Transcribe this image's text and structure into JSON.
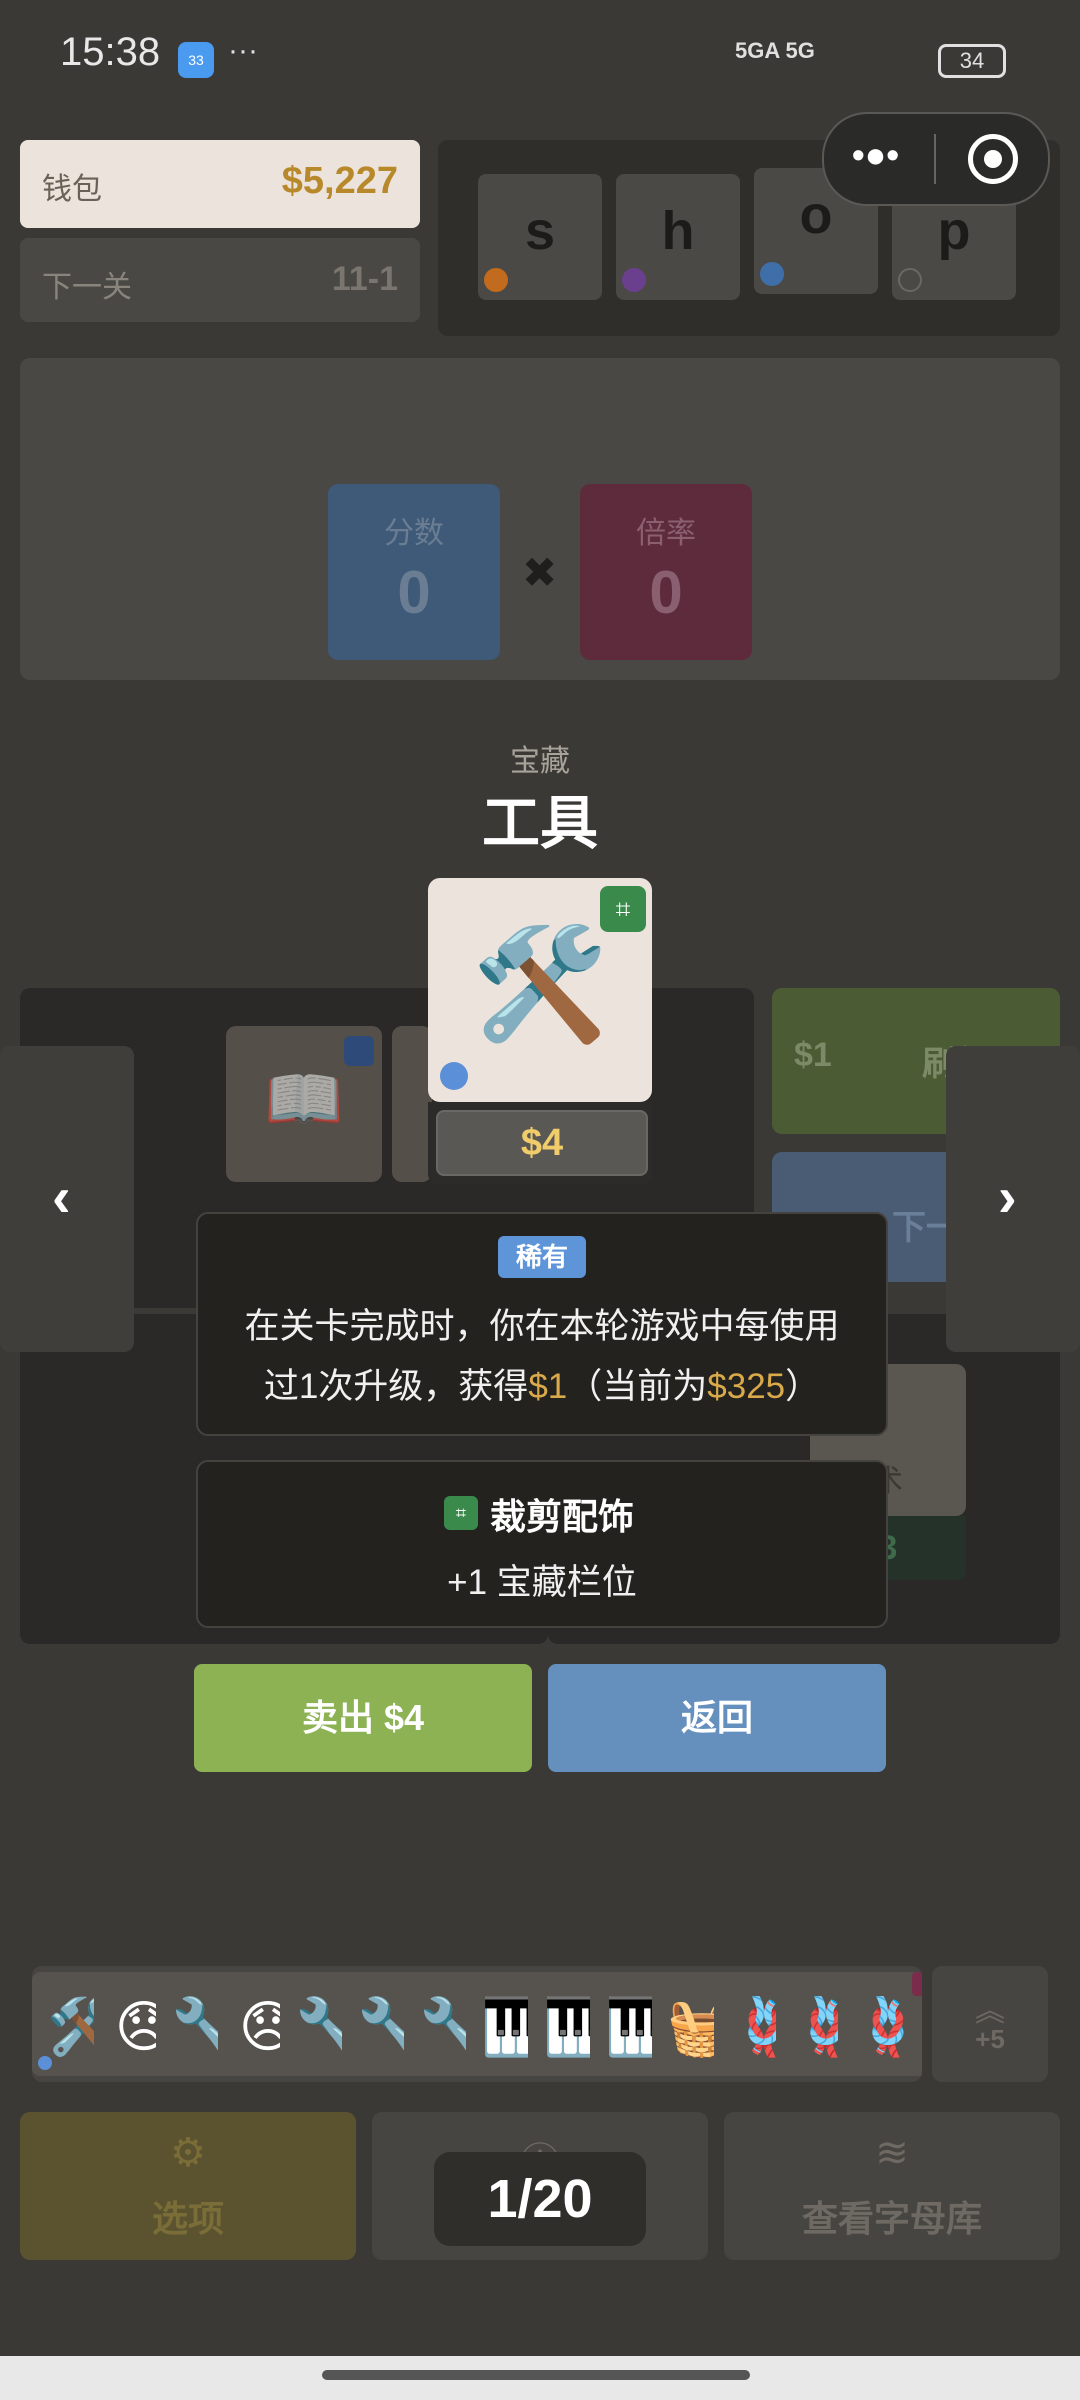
{
  "status": {
    "time": "15:38",
    "weather": "33",
    "dots": "···",
    "network": "5GA 5G",
    "battery": "34"
  },
  "header": {
    "wallet_label": "钱包",
    "wallet_value": "$5,227",
    "next_label": "下一关",
    "next_value": "11-1",
    "shop_tiles": [
      {
        "letter": "s",
        "dot": "#c26b1e"
      },
      {
        "letter": "h",
        "dot": "#6a3f8e"
      },
      {
        "letter": "o",
        "dot": "#3f6fa9"
      },
      {
        "letter": "p",
        "dot": "none"
      }
    ],
    "capsule_more": "•●•"
  },
  "scoreboard": {
    "score_label": "分数",
    "score_value": "0",
    "times": "✖",
    "mult_label": "倍率",
    "mult_value": "0",
    "score_color": "#3e5a78",
    "mult_color": "#5e2b3c"
  },
  "background": {
    "price_left": "$1",
    "refresh_label": "刷新",
    "next_level_button": "下一关",
    "arrow_left": "‹",
    "arrow_right": "›",
    "partial_price": "3",
    "partial_label": "术"
  },
  "modal": {
    "category": "宝藏",
    "title": "工具",
    "item_emoji": "🛠️",
    "item_price": "$4",
    "rarity": "稀有",
    "desc_line1": "在关卡完成时，你在本轮游戏中每使用",
    "desc_line2_a": "过1次升级，获得",
    "desc_line2_gold1": "$1",
    "desc_line2_b": "（当前为",
    "desc_line2_gold2": "$325",
    "desc_line2_c": "）",
    "accessory_title": "裁剪配饰",
    "accessory_effect": "+1 宝藏栏位",
    "sell_button": "卖出 $4",
    "back_button": "返回"
  },
  "inventory": {
    "items": [
      {
        "emoji": "🛠️",
        "badge_color": "#3a8a4c"
      },
      {
        "emoji": "😞",
        "badge_color": "#3a8a4c"
      },
      {
        "emoji": "🔧",
        "badge_color": "#3a8a4c"
      },
      {
        "emoji": "😞",
        "badge_color": "#7a2d4a"
      },
      {
        "emoji": "🔧",
        "badge_color": "#3a8a4c"
      },
      {
        "emoji": "🔧",
        "badge_color": "#7a2d4a"
      },
      {
        "emoji": "🔧",
        "badge_color": "#3a8a4c"
      },
      {
        "emoji": "🎹",
        "badge_color": "#c25a2a"
      },
      {
        "emoji": "🎹",
        "badge_color": "#c25a2a"
      },
      {
        "emoji": "🎹",
        "badge_color": "#7a2d4a"
      },
      {
        "emoji": "🧺",
        "badge_color": "#3a8a4c"
      },
      {
        "emoji": "🪢",
        "badge_color": "#c25a2a"
      },
      {
        "emoji": "🪢",
        "badge_color": "#3a8a4c"
      },
      {
        "emoji": "🪢",
        "badge_color": "#7a2d4a"
      }
    ],
    "more_count": "+5"
  },
  "nav": {
    "options_label": "选项",
    "info_label": "本轮信息",
    "library_label": "查看字母库",
    "pager": "1/20"
  }
}
